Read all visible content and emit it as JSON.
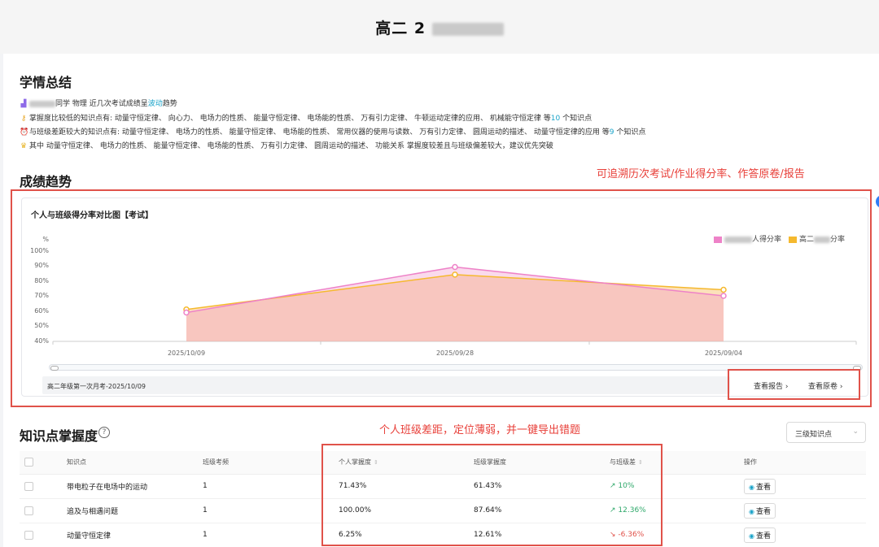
{
  "header": {
    "title_prefix": "高二 2"
  },
  "summary": {
    "heading": "学情总结",
    "trend": {
      "suffix": "同学 物理 近几次考试成绩呈",
      "highlight": "波动",
      "end": "趋势"
    },
    "low_mastery": {
      "text": "掌握度比较低的知识点有: 动量守恒定律、 向心力、 电场力的性质、 能量守恒定律、 电场能的性质、 万有引力定律、 牛顿运动定律的应用、 机械能守恒定律 等",
      "count": "10",
      "end": " 个知识点"
    },
    "gap": {
      "text": "与班级差距较大的知识点有: 动量守恒定律、 电场力的性质、 能量守恒定律、 电场能的性质、 常用仪器的使用与读数、 万有引力定律、 圆周运动的描述、 动量守恒定律的应用 等",
      "count": "9",
      "end": " 个知识点"
    },
    "priority": "其中 动量守恒定律、 电场力的性质、 能量守恒定律、 电场能的性质、 万有引力定律、 圆周运动的描述、 功能关系 掌握度较差且与班级偏差较大，建议优先突破"
  },
  "trend_section": {
    "heading": "成绩趋势",
    "annotation": "可追溯历次考试/作业得分率、作答原卷/报告",
    "chart_title": "个人与班级得分率对比图【考试】",
    "exam_label": "高二年级第一次月考-2025/10/09",
    "report_link": "查看报告",
    "paper_link": "查看原卷"
  },
  "chart_data": {
    "type": "area",
    "title": "个人与班级得分率对比图【考试】",
    "ylabel": "%",
    "ylim": [
      40,
      100
    ],
    "yticks": [
      "100%",
      "90%",
      "80%",
      "70%",
      "60%",
      "50%",
      "40%"
    ],
    "categories": [
      "2025/10/09",
      "2025/09/28",
      "2025/09/04"
    ],
    "series": [
      {
        "name": "人得分率",
        "color": "#ee82c8",
        "values": [
          59,
          89,
          70
        ]
      },
      {
        "name": "高二",
        "color": "#f5b92e",
        "values": [
          61,
          84,
          74
        ]
      }
    ],
    "legend_position": "top-right",
    "grid": false
  },
  "knowledge": {
    "heading": "知识点掌握度",
    "help": "?",
    "annotation": "个人班级差距，定位薄弱，并一键导出错题",
    "level_select": "三级知识点",
    "columns": [
      "知识点",
      "班级考频",
      "个人掌握度",
      "班级掌握度",
      "与班级差",
      "操作"
    ],
    "rows": [
      {
        "name": "带电粒子在电场中的运动",
        "freq": "1",
        "personal": "71.43%",
        "class": "61.43%",
        "diff": "10%",
        "dir": "↗",
        "action": "查看"
      },
      {
        "name": "追及与相遇问题",
        "freq": "1",
        "personal": "100.00%",
        "class": "87.64%",
        "diff": "12.36%",
        "dir": "↗",
        "action": "查看"
      },
      {
        "name": "动量守恒定律",
        "freq": "1",
        "personal": "6.25%",
        "class": "12.61%",
        "diff": "-6.36%",
        "dir": "↘",
        "action": "查看"
      }
    ]
  }
}
